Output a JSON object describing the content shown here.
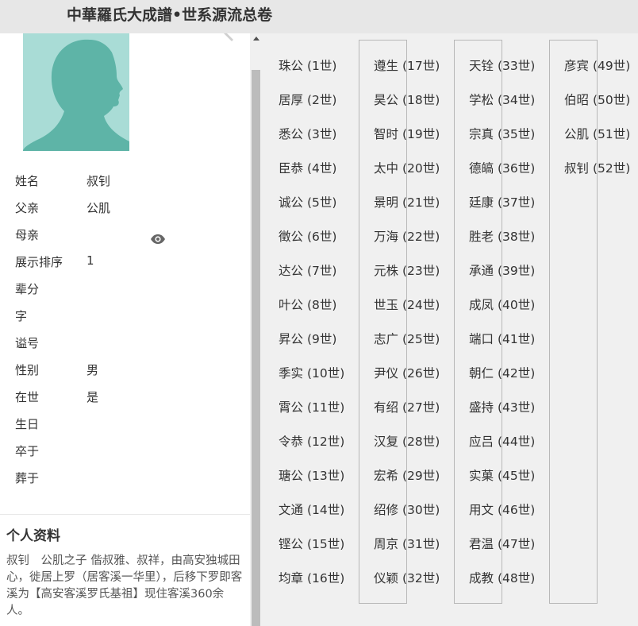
{
  "header": {
    "title": "中華羅氏大成譜•世系源流总卷"
  },
  "profile": {
    "rows": [
      {
        "label": "姓名",
        "value": "叔钊"
      },
      {
        "label": "父亲",
        "value": "公肌"
      },
      {
        "label": "母亲",
        "value": ""
      },
      {
        "label": "展示排序",
        "value": "1"
      },
      {
        "label": "辈分",
        "value": ""
      },
      {
        "label": "字",
        "value": ""
      },
      {
        "label": "谥号",
        "value": ""
      },
      {
        "label": "性别",
        "value": "男"
      },
      {
        "label": "在世",
        "value": "是"
      },
      {
        "label": "生日",
        "value": ""
      },
      {
        "label": "卒于",
        "value": ""
      },
      {
        "label": "葬于",
        "value": ""
      }
    ]
  },
  "bio": {
    "title": "个人资料",
    "text": "叔钊　公肌之子 偕叔雅、叔祥，由高安独城田心，徙居上罗（居客溪一华里），后移下罗即客溪为【高安客溪罗氏基祖】现住客溪360余人。"
  },
  "generations": [
    {
      "name": "珠公",
      "gen": "(1世)"
    },
    {
      "name": "居厚",
      "gen": "(2世)"
    },
    {
      "name": "悉公",
      "gen": "(3世)"
    },
    {
      "name": "臣恭",
      "gen": "(4世)"
    },
    {
      "name": "诚公",
      "gen": "(5世)"
    },
    {
      "name": "徵公",
      "gen": "(6世)"
    },
    {
      "name": "达公",
      "gen": "(7世)"
    },
    {
      "name": "叶公",
      "gen": "(8世)"
    },
    {
      "name": "昇公",
      "gen": "(9世)"
    },
    {
      "name": "季实",
      "gen": "(10世)"
    },
    {
      "name": "霄公",
      "gen": "(11世)"
    },
    {
      "name": "令恭",
      "gen": "(12世)"
    },
    {
      "name": "瑭公",
      "gen": "(13世)"
    },
    {
      "name": "文通",
      "gen": "(14世)"
    },
    {
      "name": "铿公",
      "gen": "(15世)"
    },
    {
      "name": "均章",
      "gen": "(16世)"
    },
    {
      "name": "遵生",
      "gen": "(17世)"
    },
    {
      "name": "昊公",
      "gen": "(18世)"
    },
    {
      "name": "智时",
      "gen": "(19世)"
    },
    {
      "name": "太中",
      "gen": "(20世)"
    },
    {
      "name": "景明",
      "gen": "(21世)"
    },
    {
      "name": "万海",
      "gen": "(22世)"
    },
    {
      "name": "元株",
      "gen": "(23世)"
    },
    {
      "name": "世玉",
      "gen": "(24世)"
    },
    {
      "name": "志广",
      "gen": "(25世)"
    },
    {
      "name": "尹仪",
      "gen": "(26世)"
    },
    {
      "name": "有绍",
      "gen": "(27世)"
    },
    {
      "name": "汉复",
      "gen": "(28世)"
    },
    {
      "name": "宏希",
      "gen": "(29世)"
    },
    {
      "name": "绍修",
      "gen": "(30世)"
    },
    {
      "name": "周京",
      "gen": "(31世)"
    },
    {
      "name": "仪颖",
      "gen": "(32世)"
    },
    {
      "name": "天铨",
      "gen": "(33世)"
    },
    {
      "name": "学松",
      "gen": "(34世)"
    },
    {
      "name": "宗真",
      "gen": "(35世)"
    },
    {
      "name": "德皜",
      "gen": "(36世)"
    },
    {
      "name": "廷康",
      "gen": "(37世)"
    },
    {
      "name": "胜老",
      "gen": "(38世)"
    },
    {
      "name": "承通",
      "gen": "(39世)"
    },
    {
      "name": "成凤",
      "gen": "(40世)"
    },
    {
      "name": "端口",
      "gen": "(41世)"
    },
    {
      "name": "朝仁",
      "gen": "(42世)"
    },
    {
      "name": "盛持",
      "gen": "(43世)"
    },
    {
      "name": "应吕",
      "gen": "(44世)"
    },
    {
      "name": "实菓",
      "gen": "(45世)"
    },
    {
      "name": "用文",
      "gen": "(46世)"
    },
    {
      "name": "君温",
      "gen": "(47世)"
    },
    {
      "name": "成教",
      "gen": "(48世)"
    },
    {
      "name": "彦宾",
      "gen": "(49世)"
    },
    {
      "name": "伯昭",
      "gen": "(50世)"
    },
    {
      "name": "公肌",
      "gen": "(51世)"
    },
    {
      "name": "叔钊",
      "gen": "(52世)"
    }
  ],
  "colors": {
    "avatar_bg": "#a9dcd6",
    "avatar_silhouette": "#5eb4a7",
    "connector": "#b8b8b8"
  },
  "icons": {
    "view": "eye-icon",
    "edit": "pen-icon",
    "avatar": "person-silhouette-icon"
  }
}
